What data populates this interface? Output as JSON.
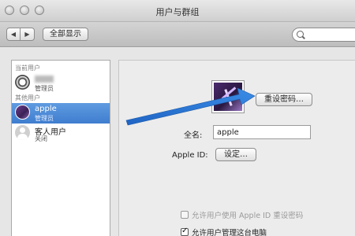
{
  "window": {
    "title": "用户与群组"
  },
  "toolbar": {
    "back_glyph": "◀",
    "forward_glyph": "▶",
    "show_all_label": "全部显示",
    "search_placeholder": ""
  },
  "sidebar": {
    "current_section": "当前用户",
    "other_section": "其他用户",
    "current_user": {
      "name": "",
      "role": "管理员",
      "icon": "soccer-ball-avatar"
    },
    "other_users": [
      {
        "name": "apple",
        "role": "管理员",
        "icon": "purple-flower-avatar",
        "selected": true
      },
      {
        "name": "客人用户",
        "role": "关闭",
        "icon": "guest-silhouette-avatar",
        "selected": false
      }
    ]
  },
  "main": {
    "reset_password_label": "重设密码…",
    "full_name_label": "全名:",
    "full_name_value": "apple",
    "apple_id_label": "Apple ID:",
    "set_button_label": "设定…",
    "allow_reset_with_appleid": "允许用户使用 Apple ID 重设密码",
    "allow_admin": "允许用户管理这台电脑",
    "allow_reset_checked": false,
    "allow_admin_checked": true
  },
  "colors": {
    "selection": "#3f7dcf",
    "annotation_arrow": "#2f7fd6"
  }
}
